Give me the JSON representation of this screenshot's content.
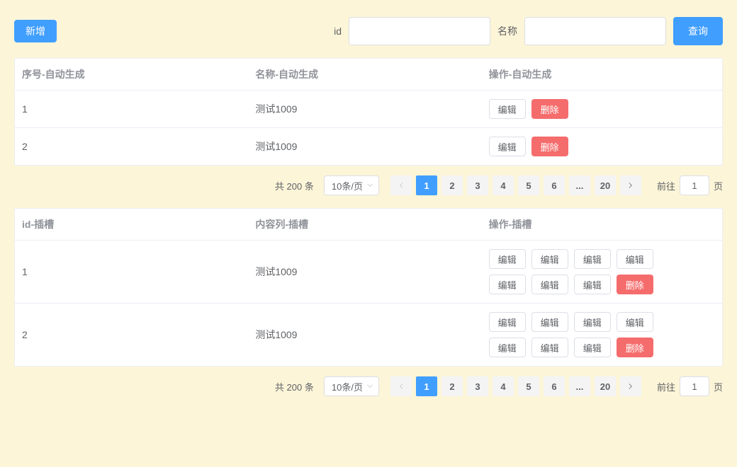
{
  "toolbar": {
    "add_label": "新增",
    "id_label": "id",
    "name_label": "名称",
    "search_label": "查询"
  },
  "table1": {
    "headers": {
      "seq": "序号-自动生成",
      "name": "名称-自动生成",
      "ops": "操作-自动生成"
    },
    "rows": [
      {
        "seq": "1",
        "name": "测试1009"
      },
      {
        "seq": "2",
        "name": "测试1009"
      }
    ],
    "ops": {
      "edit": "编辑",
      "delete": "删除"
    }
  },
  "table2": {
    "headers": {
      "seq": "id-插槽",
      "name": "内容列-插槽",
      "ops": "操作-插槽"
    },
    "rows": [
      {
        "seq": "1",
        "name": "测试1009"
      },
      {
        "seq": "2",
        "name": "测试1009"
      }
    ],
    "ops": {
      "edit": "编辑",
      "delete": "删除"
    }
  },
  "pagination": {
    "total_prefix": "共",
    "total_count": "200",
    "total_suffix": "条",
    "page_size_label": "10条/页",
    "pages": [
      "1",
      "2",
      "3",
      "4",
      "5",
      "6",
      "...",
      "20"
    ],
    "current": "1",
    "jump_prefix": "前往",
    "jump_value": "1",
    "jump_suffix": "页"
  }
}
